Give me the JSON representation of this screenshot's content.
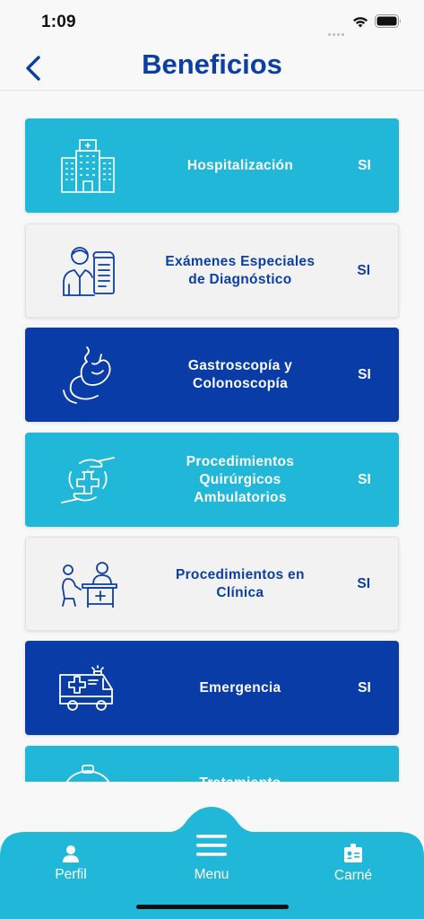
{
  "status_bar": {
    "time": "1:09"
  },
  "header": {
    "title": "Beneficios"
  },
  "benefits": [
    {
      "label": "Hospitalización",
      "value": "SI",
      "icon": "hospital-building-icon"
    },
    {
      "label": "Exámenes Especiales\nde Diagnóstico",
      "value": "SI",
      "icon": "doctor-report-icon"
    },
    {
      "label": "Gastroscopía y\nColonoscopía",
      "value": "SI",
      "icon": "stomach-icon"
    },
    {
      "label": "Procedimientos\nQuirúrgicos\nAmbulatorios",
      "value": "SI",
      "icon": "hands-medical-cross-icon"
    },
    {
      "label": "Procedimientos en\nClínica",
      "value": "SI",
      "icon": "doctor-desk-icon"
    },
    {
      "label": "Emergencia",
      "value": "SI",
      "icon": "ambulance-icon"
    },
    {
      "label": "Tratamiento",
      "value": "",
      "icon": "partial-icon"
    }
  ],
  "tabbar": {
    "perfil": "Perfil",
    "menu": "Menu",
    "carne": "Carné"
  },
  "colors": {
    "cyan": "#20b7d8",
    "navy": "#0a3ca8",
    "title_blue": "#0c3fa3",
    "gray_card": "#f2f2f2"
  }
}
